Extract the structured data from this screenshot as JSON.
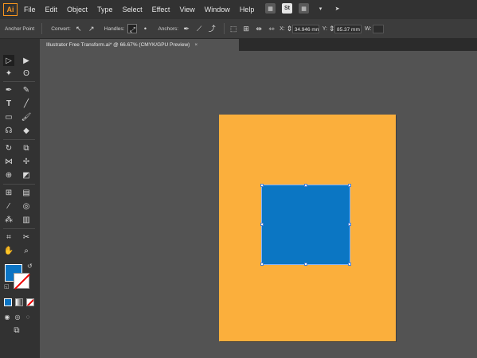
{
  "app": {
    "logo": "Ai"
  },
  "menu": [
    "File",
    "Edit",
    "Object",
    "Type",
    "Select",
    "Effect",
    "View",
    "Window",
    "Help"
  ],
  "menubar_icons": [
    {
      "name": "libraries-icon",
      "glyph": "▦"
    },
    {
      "name": "stock-badge-icon",
      "glyph": "St"
    },
    {
      "name": "workspace-grid-icon",
      "glyph": "▦"
    },
    {
      "name": "dropdown-chevron-icon",
      "glyph": "▾"
    },
    {
      "name": "send-arrow-icon",
      "glyph": "➤"
    }
  ],
  "control_bar": {
    "anchor_point_label": "Anchor Point",
    "convert_label": "Convert:",
    "handles_label": "Handles:",
    "anchors_label": "Anchors:",
    "x_label": "X:",
    "x_value": "34.946 mm",
    "y_label": "Y:",
    "y_value": "85.37 mm",
    "w_label": "W:"
  },
  "document_tab": {
    "title": "Illustrator Free Transform.ai* @ 66.67% (CMYK/GPU Preview)",
    "close": "×"
  },
  "colors": {
    "artboard_fill": "#fbaf3c",
    "shape_fill": "#0b76c3",
    "app_accent": "#f7941d"
  }
}
